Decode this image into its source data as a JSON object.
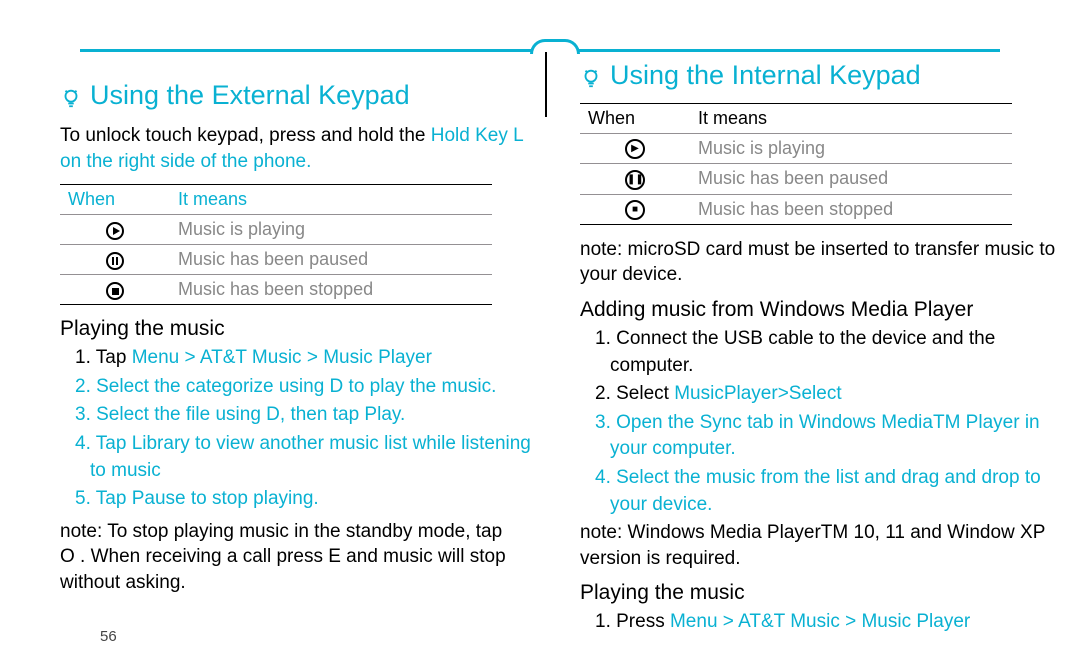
{
  "left": {
    "title": "Using the External Keypad",
    "intro_plain": "To unlock touch keypad, press and hold the",
    "intro_teal1": "Hold Key L",
    "intro_teal2": " on the right side of the phone.",
    "table": {
      "h1": "When",
      "h2": "It means",
      "rows": [
        {
          "meaning": "Music is playing"
        },
        {
          "meaning": "Music has been paused"
        },
        {
          "meaning": "Music has been stopped"
        }
      ]
    },
    "playing_title": "Playing the music",
    "steps": {
      "s1a": "1. Tap",
      "s1b": "Menu > AT&T Music > Music Player",
      "s2a": "2. Select the categorize using ",
      "s2b": "D",
      "s2c": " to play the music.",
      "s3a": "3. Select the file using ",
      "s3b": "D",
      "s3c": ", then tap ",
      "s3d": "Play.",
      "s4a": "4. Tap ",
      "s4b": "Library",
      "s4c": " to view another music list while listening to music",
      "s5a": "5. Tap ",
      "s5b": "Pause",
      "s5c": " to stop playing."
    },
    "note1a": "note:   To stop playing music in the standby mode, tap",
    "note1b": "O       . When receiving a call press ",
    "note1c": "E",
    "note1d": "     and music will stop without asking."
  },
  "right": {
    "title": "Using the Internal Keypad",
    "table": {
      "h1": "When",
      "h2": "It means",
      "rows": [
        {
          "meaning": "Music is playing"
        },
        {
          "meaning": "Music has been paused"
        },
        {
          "meaning": "Music has been stopped"
        }
      ]
    },
    "note_sd": "note:   microSD card must be inserted to transfer music to your device.",
    "adding_title": "Adding music from Windows Media Player",
    "steps": {
      "s1": "1. Connect the USB cable to the device and the computer.",
      "s2a": "2. Select ",
      "s2b": "MusicPlayer>Select",
      "s3a": "3. Open the Sync tab in Windows Media",
      "s3b": "TM",
      "s3c": " Player in your computer.",
      "s4": "4. Select the music from the list and drag and drop to your device."
    },
    "note_wmp_a": "note:   Windows Media Player",
    "note_wmp_b": "TM",
    "note_wmp_c": " 10, 11 and Window XP version is required.",
    "playing_title": "Playing the music",
    "play_s1a": "1. Press ",
    "play_s1b": "Menu > AT&T Music > Music Player"
  },
  "page_num": "56"
}
